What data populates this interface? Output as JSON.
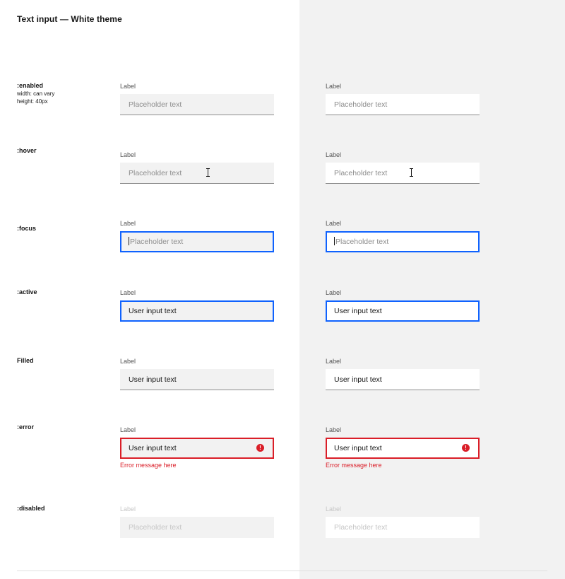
{
  "page": {
    "title": "Text input — White theme"
  },
  "states": [
    {
      "name": ":enabled",
      "notes": [
        "width: can vary",
        "height: 40px"
      ]
    },
    {
      "name": ":hover"
    },
    {
      "name": ":focus"
    },
    {
      "name": ":active"
    },
    {
      "name": "Filled"
    },
    {
      "name": ":error"
    },
    {
      "name": ":disabled"
    }
  ],
  "field": {
    "label": "Label",
    "placeholder": "Placeholder text",
    "user_input": "User input text",
    "error_message": "Error message here"
  },
  "colors": {
    "focus_border": "#0f62fe",
    "error": "#da1e28",
    "field_gray": "#f2f2f2",
    "field_white": "#ffffff",
    "panel_gray": "#f2f2f2"
  },
  "icons": {
    "error": "warning-filled-icon",
    "cursor": "text-cursor-icon"
  }
}
